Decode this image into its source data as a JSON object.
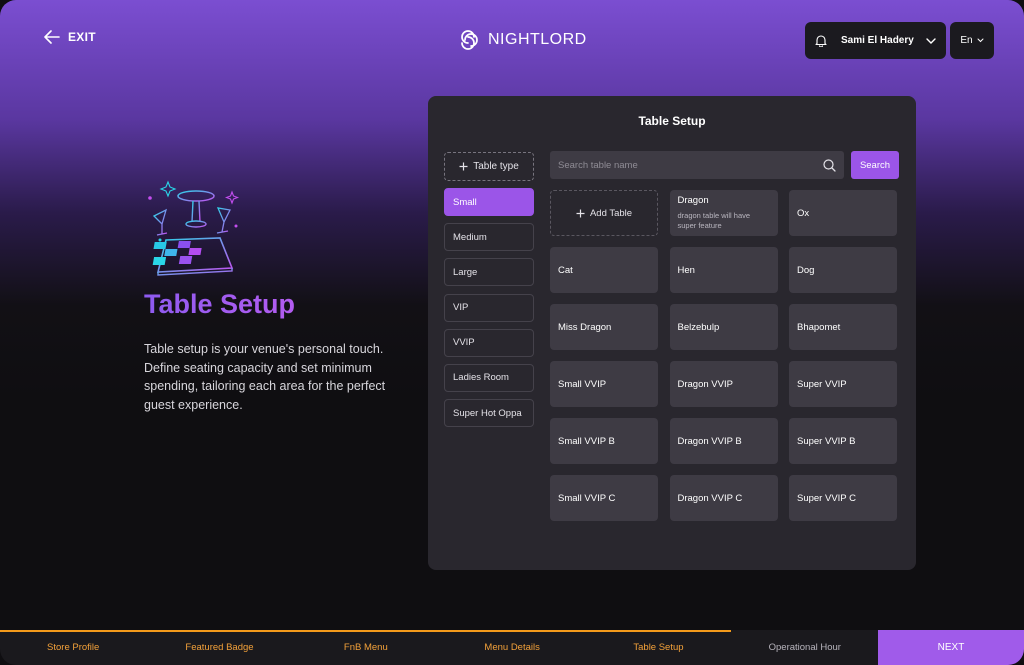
{
  "header": {
    "exit_label": "EXIT",
    "logo_text": "NIGHTLORD",
    "user_name": "Sami El Hadery",
    "language": "En"
  },
  "hero": {
    "title": "Table Setup",
    "description": "Table setup is your venue's personal touch. Define seating capacity and set minimum spending, tailoring each area for the perfect guest experience."
  },
  "panel": {
    "title": "Table Setup",
    "add_type_label": "Table type",
    "table_types": [
      {
        "label": "Small",
        "active": true
      },
      {
        "label": "Medium",
        "active": false
      },
      {
        "label": "Large",
        "active": false
      },
      {
        "label": "VIP",
        "active": false
      },
      {
        "label": "VVIP",
        "active": false
      },
      {
        "label": "Ladies Room",
        "active": false
      },
      {
        "label": "Super Hot Oppa",
        "active": false
      }
    ],
    "search": {
      "placeholder": "Search table name",
      "value": "",
      "button_label": "Search"
    },
    "add_table_label": "Add Table",
    "tables": [
      {
        "name": "Dragon",
        "description": "dragon table will have super feature"
      },
      {
        "name": "Ox"
      },
      {
        "name": "Cat"
      },
      {
        "name": "Hen"
      },
      {
        "name": "Dog"
      },
      {
        "name": "Miss Dragon"
      },
      {
        "name": "Belzebulp"
      },
      {
        "name": "Bhapomet"
      },
      {
        "name": "Small VVIP"
      },
      {
        "name": "Dragon VVIP"
      },
      {
        "name": "Super VVIP"
      },
      {
        "name": "Small VVIP B"
      },
      {
        "name": "Dragon VVIP B"
      },
      {
        "name": "Super VVIP B"
      },
      {
        "name": "Small VVIP C"
      },
      {
        "name": "Dragon VVIP C"
      },
      {
        "name": "Super VVIP C"
      }
    ]
  },
  "footer": {
    "steps": [
      {
        "label": "Store Profile",
        "done": true
      },
      {
        "label": "Featured Badge",
        "done": true
      },
      {
        "label": "FnB Menu",
        "done": true
      },
      {
        "label": "Menu Details",
        "done": true
      },
      {
        "label": "Table Setup",
        "done": true
      },
      {
        "label": "Operational Hour",
        "done": false
      }
    ],
    "progress_fraction": 0.833,
    "next_label": "NEXT"
  },
  "colors": {
    "accent": "#9b55e8",
    "progress": "#f39a1b",
    "panel_bg": "#29272e",
    "card_bg": "#3e3b44"
  }
}
